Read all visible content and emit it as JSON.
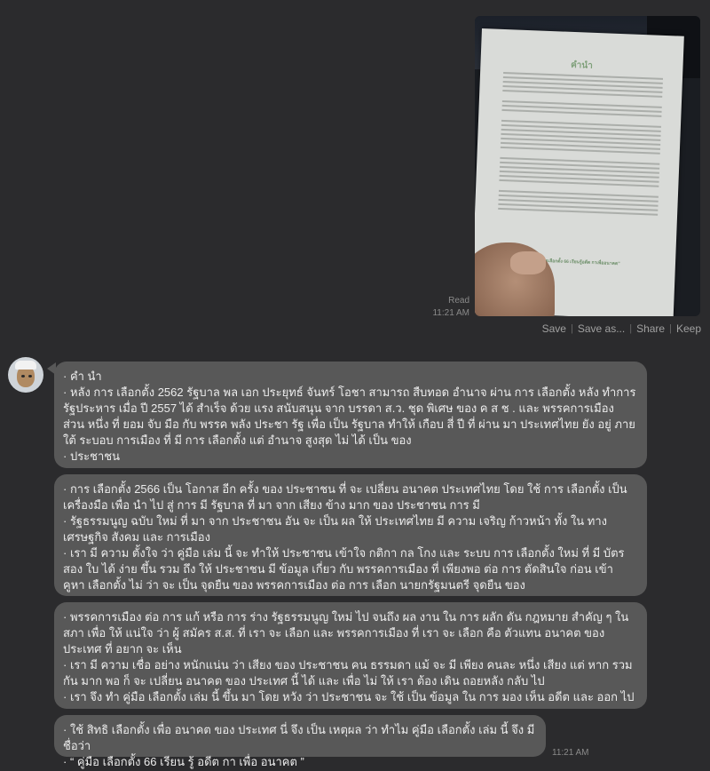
{
  "sent": {
    "status": "Read",
    "time": "11:21 AM",
    "image": {
      "page_title": "คำนำ",
      "page_footer": "“คู่มือเลือกตั้ง 66 เรียนรู้อดีต กาเพื่ออนาคต”"
    },
    "actions": [
      "Save",
      "Save as...",
      "Share",
      "Keep"
    ]
  },
  "received": {
    "time": "11:21 AM",
    "bubbles": [
      {
        "lines": [
          "· คำ นำ",
          "· หลัง การ เลือกตั้ง 2562 รัฐบาล พล เอก ประยุทธ์ จันทร์ โอชา สามารถ สืบทอด อำนาจ ผ่าน การ เลือกตั้ง หลัง ทำการ รัฐประหาร เมื่อ ปี 2557 ได้ สำเร็จ ด้วย แรง สนับสนุน จาก บรรดา ส.ว. ชุด พิเศษ ของ ค ส ช . และ พรรคการเมือง ส่วน หนึ่ง ที่ ยอม จับ มือ กับ พรรค พลัง ประชา รัฐ เพื่อ เป็น รัฐบาล ทำให้ เกือบ สี่ ปี ที่ ผ่าน มา ประเทศไทย ยัง อยู่ ภาย ใต้ ระบอบ การเมือง ที่ มี การ เลือกตั้ง แต่ อำนาจ สูงสุด ไม่ ได้ เป็น ของ",
          "· ประชาชน"
        ]
      },
      {
        "lines": [
          "· การ เลือกตั้ง 2566 เป็น โอกาส อีก ครั้ง ของ ประชาชน ที่ จะ เปลี่ยน อนาคต ประเทศไทย โดย ใช้ การ เลือกตั้ง เป็น เครื่องมือ เพื่อ นำ ไป สู่ การ มี รัฐบาล ที่ มา จาก เสียง ข้าง มาก ของ ประชาชน การ มี",
          "· รัฐธรรมนูญ ฉบับ ใหม่ ที่ มา จาก ประชาชน อัน จะ เป็น ผล ให้ ประเทศไทย มี ความ เจริญ ก้าวหน้า ทั้ง ใน ทาง เศรษฐกิจ สังคม และ การเมือง",
          "· เรา มี ความ ตั้งใจ ว่า คู่มือ เล่ม นี้ จะ ทำให้ ประชาชน เข้าใจ กติกา กล โกง และ ระบบ การ เลือกตั้ง ใหม่ ที่ มี บัตร สอง ใบ ได้ ง่าย ขึ้น รวม ถึง ให้ ประชาชน มี ข้อมูล เกี่ยว กับ พรรคการเมือง ที่ เพียงพอ ต่อ การ ตัดสินใจ ก่อน เข้า คูหา เลือกตั้ง ไม่ ว่า จะ เป็น จุดยืน ของ พรรคการเมือง ต่อ การ เลือก นายกรัฐมนตรี จุดยืน ของ"
        ]
      },
      {
        "lines": [
          "· พรรคการเมือง ต่อ การ แก้ หรือ การ ร่าง รัฐธรรมนูญ ใหม่ ไป จนถึง ผล งาน ใน การ ผลัก ดัน กฎหมาย สำคัญ ๆ ใน สภา เพื่อ ให้ แน่ใจ ว่า ผู้ สมัคร ส.ส. ที่ เรา จะ เลือก และ พรรคการเมือง ที่ เรา จะ เลือก คือ ตัวแทน อนาคต ของ ประเทศ ที่ อยาก จะ เห็น",
          "· เรา มี ความ เชื่อ อย่าง หนักแน่น ว่า เสียง ของ ประชาชน คน ธรรมดา แม้ จะ มี เพียง คนละ หนึ่ง เสียง แต่ หาก รวม กัน มาก พอ ก็ จะ เปลี่ยน อนาคต ของ ประเทศ นี้ ได้ และ เพื่อ ไม่ ให้ เรา ต้อง เดิน ถอยหลัง กลับ ไป",
          "· เรา จึง ทำ คู่มือ เลือกตั้ง เล่ม นี้ ขึ้น มา โดย หวัง ว่า ประชาชน จะ ใช้ เป็น ข้อมูล ใน การ มอง เห็น อดีต และ ออก ไป"
        ]
      },
      {
        "lines": [
          "· ใช้ สิทธิ เลือกตั้ง เพื่อ อนาคต ของ ประเทศ นี่ จึง เป็น เหตุผล ว่า ทำไม คู่มือ เลือกตั้ง เล่ม นี้ จึง มี ชื่อว่า",
          "· “ คู่มือ เลือกตั้ง 66 เรียน รู้ อดีต กา เพื่อ อนาคต ”"
        ]
      }
    ]
  }
}
